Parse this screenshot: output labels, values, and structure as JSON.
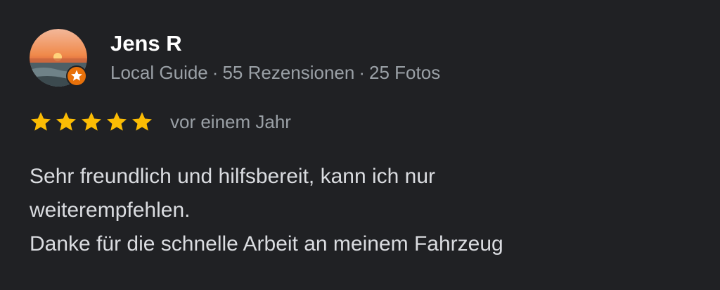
{
  "reviewer": {
    "name": "Jens R",
    "role": "Local Guide",
    "reviews": "55 Rezensionen",
    "photos": "25 Fotos",
    "separator": "·",
    "avatar_icon": "sunset-photo-avatar",
    "badge_icon": "local-guide-star-badge"
  },
  "rating": {
    "stars": 5,
    "max_stars": 5,
    "date": "vor einem Jahr"
  },
  "review": {
    "line1": "Sehr freundlich und hilfsbereit, kann ich nur",
    "line2": "weiterempfehlen.",
    "line3": "Danke für die schnelle Arbeit an meinem Fahrzeug"
  },
  "colors": {
    "background": "#202124",
    "star": "#fbbc04",
    "badge": "#e8710a",
    "name": "#ffffff",
    "secondary_text": "#9aa0a6",
    "body_text": "#dadce0"
  }
}
